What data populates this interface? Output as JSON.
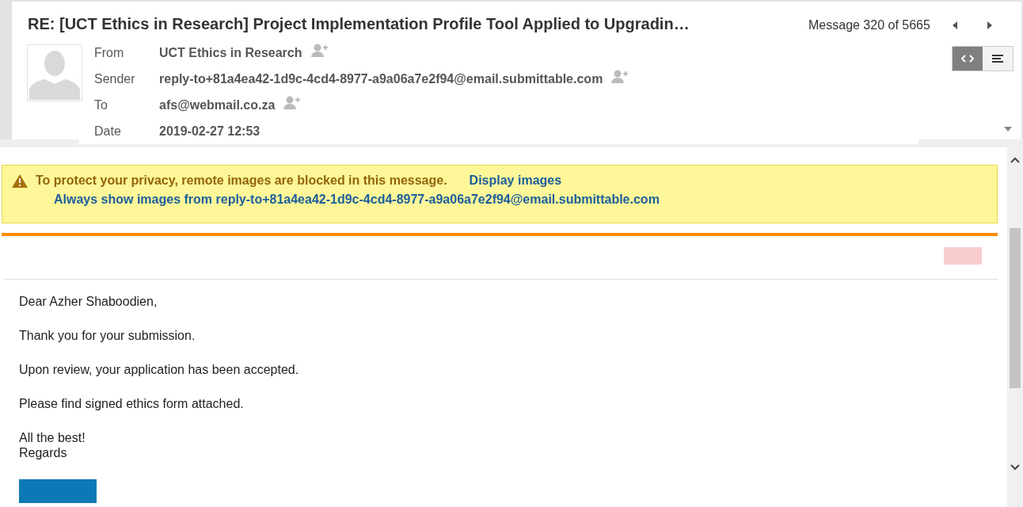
{
  "message": {
    "subject": "RE: [UCT Ethics in Research] Project Implementation Profile Tool Applied to Upgradin…",
    "position": "Message 320 of 5665"
  },
  "fields": [
    {
      "label": "From",
      "value": "UCT Ethics in Research",
      "add_contact": true
    },
    {
      "label": "Sender",
      "value": "reply-to+81a4ea42-1d9c-4cd4-8977-a9a06a7e2f94@email.submittable.com",
      "add_contact": true
    },
    {
      "label": "To",
      "value": "afs@webmail.co.za",
      "add_contact": true
    },
    {
      "label": "Date",
      "value": "2019-02-27 12:53",
      "add_contact": false
    }
  ],
  "view_buttons": [
    {
      "kind": "source",
      "selected": true
    },
    {
      "kind": "text",
      "selected": false
    }
  ],
  "notice": {
    "text": "To protect your privacy, remote images are blocked in this message.",
    "display_link": "Display images",
    "always_link": "Always show images from reply-to+81a4ea42-1d9c-4cd4-8977-a9a06a7e2f94@email.submittable.com"
  },
  "body": {
    "paragraphs": [
      [
        "Dear Azher Shaboodien,"
      ],
      [
        "Thank you for your submission."
      ],
      [
        "Upon review, your application has been accepted."
      ],
      [
        "Please find signed ethics form attached."
      ],
      [
        "All the best!",
        "Regards"
      ]
    ]
  }
}
